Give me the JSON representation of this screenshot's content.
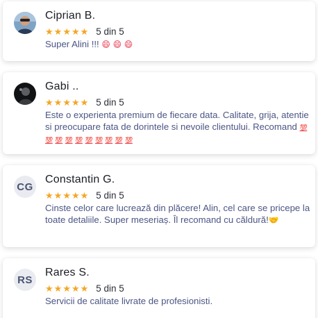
{
  "reviews": [
    {
      "name": "Ciprian B.",
      "stars": 5,
      "star_glyph": "★",
      "score": "5 din 5",
      "text": "Super Alini !!!",
      "emoji": [
        "😄",
        "😄",
        "😄"
      ],
      "avatar": "photo"
    },
    {
      "name": "Gabi ..",
      "stars": 5,
      "star_glyph": "★",
      "score": "5 din 5",
      "text": "Este o experienta premium de fiecare data. Calitate, grija, atentie si preocupare fata de dorintele si nevoile clientului. Recomand",
      "emoji": [
        "💯",
        "💯",
        "💯",
        "💯",
        "💯",
        "💯",
        "💯",
        "💯",
        "💯",
        "💯"
      ],
      "avatar": "photo"
    },
    {
      "name": "Constantin G.",
      "stars": 5,
      "star_glyph": "★",
      "score": "5 din 5",
      "text": "Cinste celor care lucrează din plăcere! Alin, cel care se pricepe la toate detaliile. Super meseriaș. Îl recomand cu căldură!",
      "emoji": [
        "🤝"
      ],
      "avatar_initials": "CG"
    },
    {
      "name": "Rares S.",
      "stars": 5,
      "star_glyph": "★",
      "score": "5 din 5",
      "text": "Servicii de calitate livrate de profesionisti.",
      "emoji": [],
      "avatar_initials": "RS"
    }
  ],
  "colors": {
    "star": "#f4a623",
    "review_text": "#4b5584",
    "name": "#1b1d24",
    "initials_bg": "#e9ebf1",
    "initials_text": "#4a5470"
  }
}
